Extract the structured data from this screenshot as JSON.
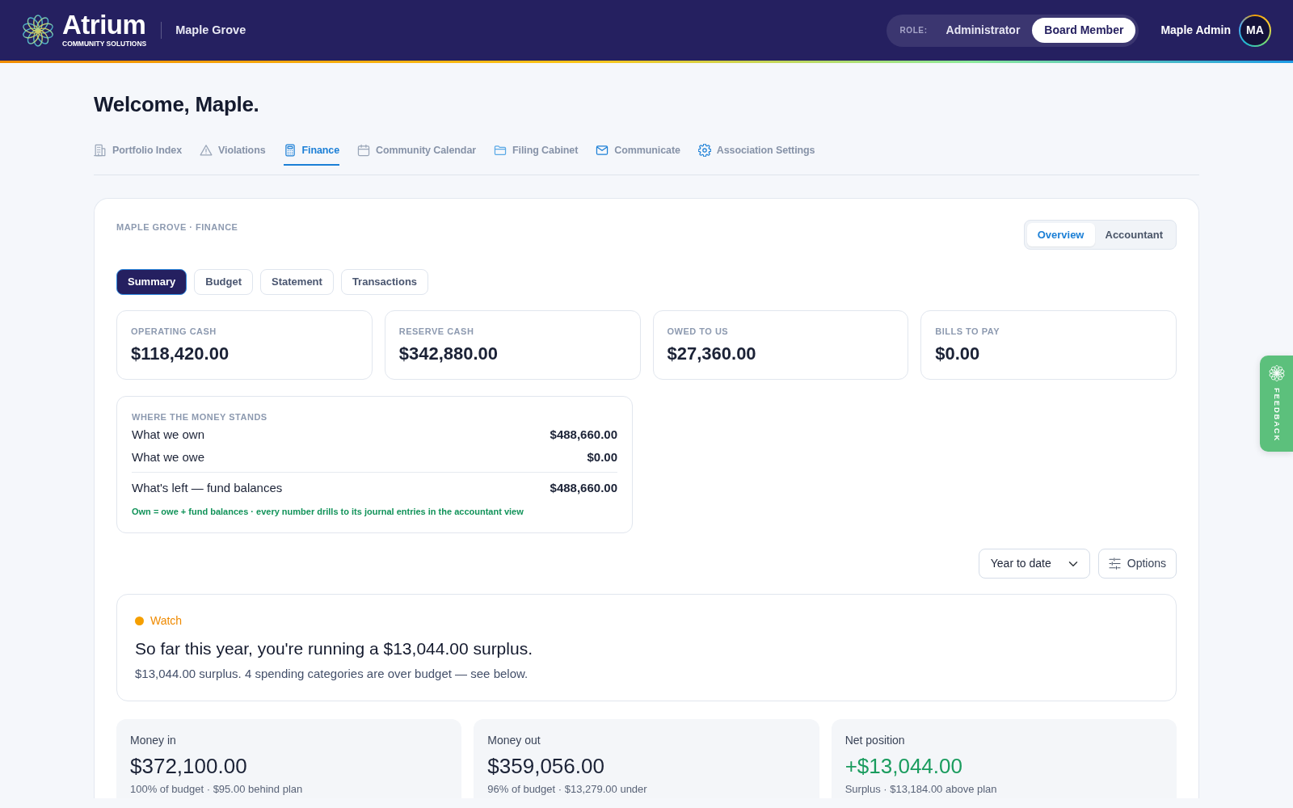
{
  "header": {
    "brand_name": "Atrium",
    "brand_tagline": "COMMUNITY SOLUTIONS",
    "community": "Maple Grove",
    "role_switch": {
      "label": "ROLE:",
      "options": [
        {
          "label": "Administrator",
          "selected": false
        },
        {
          "label": "Board Member",
          "selected": true
        }
      ]
    },
    "user": {
      "name": "Maple Admin",
      "initials": "MA"
    }
  },
  "greeting": "Welcome, Maple.",
  "nav_tabs": [
    {
      "label": "Portfolio Index",
      "selected": false
    },
    {
      "label": "Violations",
      "selected": false
    },
    {
      "label": "Finance",
      "selected": true
    },
    {
      "label": "Community Calendar",
      "selected": false
    },
    {
      "label": "Filing Cabinet",
      "selected": false
    },
    {
      "label": "Communicate",
      "selected": false
    },
    {
      "label": "Association Settings",
      "selected": false
    }
  ],
  "finance": {
    "breadcrumb": "MAPLE GROVE · FINANCE",
    "view_toggle": [
      {
        "label": "Overview",
        "selected": true
      },
      {
        "label": "Accountant",
        "selected": false
      }
    ],
    "sub_tabs": [
      {
        "label": "Summary",
        "selected": true
      },
      {
        "label": "Budget",
        "selected": false
      },
      {
        "label": "Statement",
        "selected": false
      },
      {
        "label": "Transactions",
        "selected": false
      }
    ],
    "stats": [
      {
        "label": "OPERATING CASH",
        "value": "$118,420.00"
      },
      {
        "label": "RESERVE CASH",
        "value": "$342,880.00"
      },
      {
        "label": "OWED TO US",
        "value": "$27,360.00"
      },
      {
        "label": "BILLS TO PAY",
        "value": "$0.00"
      }
    ],
    "money_stands": {
      "title": "WHERE THE MONEY STANDS",
      "rows": [
        {
          "kind": "item",
          "label": "What we own",
          "value": "$488,660.00"
        },
        {
          "kind": "item",
          "label": "What we owe",
          "value": "$0.00"
        },
        {
          "kind": "total",
          "label": "What's left — fund balances",
          "value": "$488,660.00"
        }
      ],
      "note": "Own = owe + fund balances · every number drills to its journal entries in the accountant view"
    },
    "period_select": {
      "value": "Year to date"
    },
    "options_button": "Options",
    "status_card": {
      "status": "Watch",
      "headline": "So far this year, you're running a $13,044.00 surplus.",
      "detail": "$13,044.00 surplus. 4 spending categories are over budget — see below."
    },
    "summary_cards": [
      {
        "kind": "neutral",
        "label": "Money in",
        "value": "$372,100.00",
        "note": "100% of budget · $95.00 behind plan"
      },
      {
        "kind": "neutral",
        "label": "Money out",
        "value": "$359,056.00",
        "note": "96% of budget · $13,279.00 under"
      },
      {
        "kind": "positive",
        "label": "Net position",
        "value": "+$13,044.00",
        "note": "Surplus · $13,184.00 above plan"
      }
    ]
  },
  "feedback_tab": {
    "label": "FEEDBACK"
  }
}
